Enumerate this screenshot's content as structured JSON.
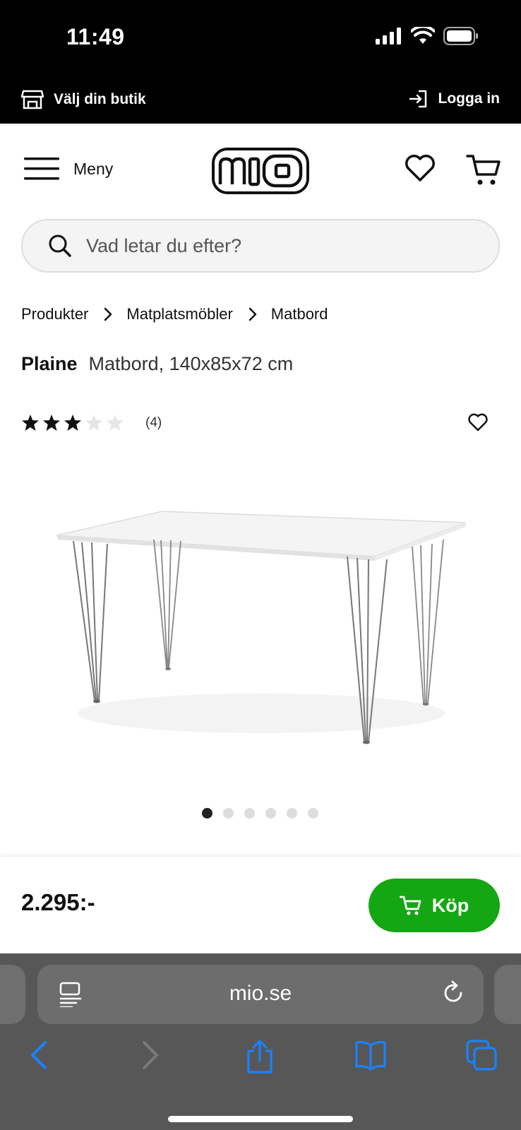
{
  "status_bar": {
    "time": "11:49"
  },
  "top_bar": {
    "store_label": "Välj din butik",
    "login_label": "Logga in"
  },
  "header": {
    "menu_label": "Meny",
    "logo_text": "mio"
  },
  "search": {
    "placeholder": "Vad letar du efter?"
  },
  "breadcrumb": [
    "Produkter",
    "Matplatsmöbler",
    "Matbord"
  ],
  "product": {
    "brand": "Plaine",
    "description": "Matbord, 140x85x72 cm",
    "rating": 3.5,
    "rating_max": 5,
    "review_count": "(4)",
    "image_count": 6,
    "active_image": 1
  },
  "buy_bar": {
    "price": "2.295:-",
    "buy_label": "Köp"
  },
  "browser": {
    "url": "mio.se"
  },
  "colors": {
    "accent": "#15a614",
    "header_bg": "#000000",
    "browser_bg": "#575757",
    "link_blue": "#1a82ff"
  }
}
